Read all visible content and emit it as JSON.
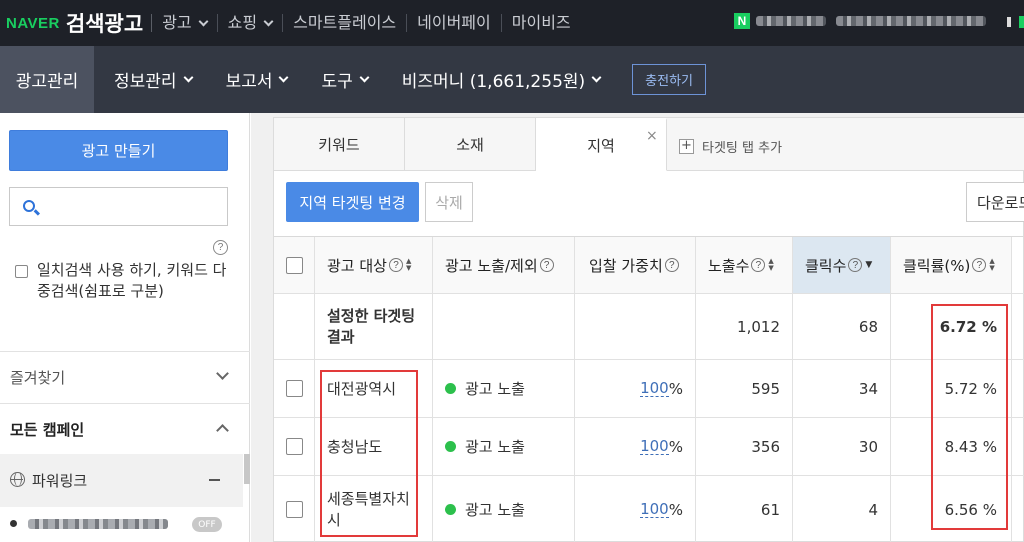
{
  "topbar": {
    "brand_naver": "NAVER",
    "brand_product": "검색광고",
    "nav": [
      "광고",
      "쇼핑",
      "스마트플레이스",
      "네이버페이",
      "마이비즈"
    ],
    "user_badge": "N"
  },
  "subnav": {
    "active": "광고관리",
    "items": [
      "정보관리",
      "보고서",
      "도구",
      "비즈머니 (1,661,255원)"
    ],
    "charge_button": "충전하기"
  },
  "sidebar": {
    "create_button": "광고 만들기",
    "search_placeholder": "",
    "exact_search_label": "일치검색 사용 하기, 키워드 다중검색(쉼표로 구분)",
    "favorites": "즐겨찾기",
    "all_campaigns": "모든 캠페인",
    "powerlink": "파워링크",
    "campaign_toggle": "OFF"
  },
  "tabs": {
    "items": [
      "키워드",
      "소재",
      "지역"
    ],
    "active_index": 2,
    "close": "×",
    "add_tab": "타겟팅 탭 추가"
  },
  "toolbar": {
    "change_targeting": "지역 타겟팅 변경",
    "delete": "삭제",
    "download": "다운로드"
  },
  "table": {
    "headers": {
      "target": "광고 대상",
      "exposure": "광고 노출/제외",
      "bid_weight": "입찰 가중치",
      "impressions": "노출수",
      "clicks": "클릭수",
      "ctr": "클릭률(%)"
    },
    "summary": {
      "label": "설정한 타겟팅 결과",
      "impressions": "1,012",
      "clicks": "68",
      "ctr": "6.72 %"
    },
    "rows": [
      {
        "target": "대전광역시",
        "exposure": "광고 노출",
        "bid_value": "100",
        "bid_unit": "%",
        "impressions": "595",
        "clicks": "34",
        "ctr": "5.72 %"
      },
      {
        "target": "충청남도",
        "exposure": "광고 노출",
        "bid_value": "100",
        "bid_unit": "%",
        "impressions": "356",
        "clicks": "30",
        "ctr": "8.43 %"
      },
      {
        "target": "세종특별자치시",
        "exposure": "광고 노출",
        "bid_value": "100",
        "bid_unit": "%",
        "impressions": "61",
        "clicks": "4",
        "ctr": "6.56 %"
      }
    ]
  },
  "colors": {
    "topbar_bg": "#1e2128",
    "subbar_bg": "#333843",
    "primary_button": "#4a8ae6",
    "naver_green": "#19ce60",
    "highlight_box": "#e23a3a",
    "status_dot": "#2cc04c"
  }
}
